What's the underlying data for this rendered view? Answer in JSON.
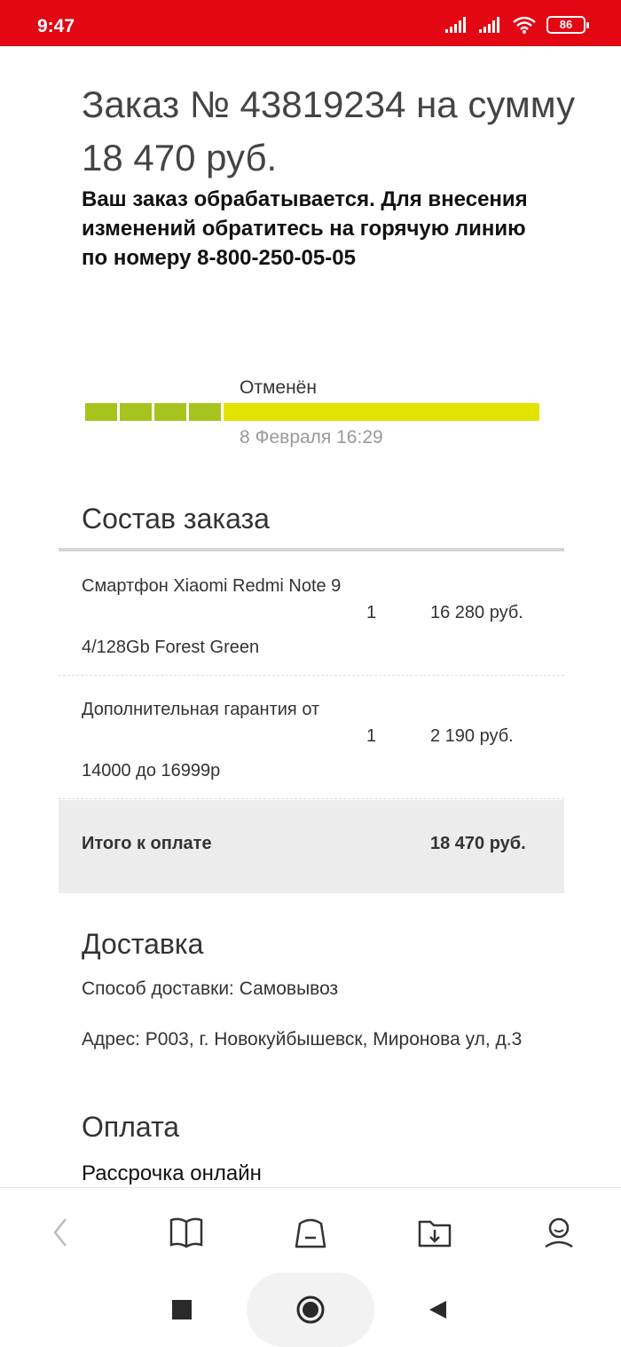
{
  "status_bar": {
    "time": "9:47",
    "battery": "86"
  },
  "order": {
    "title": "Заказ № 43819234 на сумму 18 470 руб.",
    "note": "Ваш заказ обрабатывается. Для внесения изменений обратитесь на горячую линию по номеру 8-800-250-05-05"
  },
  "progress": {
    "status": "Отменён",
    "date": "8 Февраля 16:29",
    "colors": {
      "done": "#a6c41e",
      "current": "#e3e300"
    }
  },
  "composition": {
    "title": "Состав заказа",
    "items": [
      {
        "name_line1": "Смартфон Xiaomi Redmi Note 9",
        "name_line2": "4/128Gb Forest Green",
        "qty": "1",
        "price": "16 280 руб."
      },
      {
        "name_line1": "Дополнительная гарантия от",
        "name_line2": "14000 до 16999р",
        "qty": "1",
        "price": "2 190 руб."
      }
    ],
    "total_label": "Итого к оплате",
    "total_value": "18 470 руб."
  },
  "delivery": {
    "title": "Доставка",
    "method": "Способ доставки: Самовывоз",
    "address": "Адрес: Р003, г. Новокуйбышевск, Миронова ул, д.3"
  },
  "payment": {
    "title": "Оплата",
    "method": "Рассрочка онлайн"
  },
  "bottom_nav": [
    "back-icon",
    "catalog-book-icon",
    "cart-icon",
    "downloads-folder-icon",
    "profile-icon"
  ],
  "system_nav": [
    "recent-apps-icon",
    "home-icon",
    "back-icon"
  ],
  "colors": {
    "status_bar": "#e30613"
  }
}
